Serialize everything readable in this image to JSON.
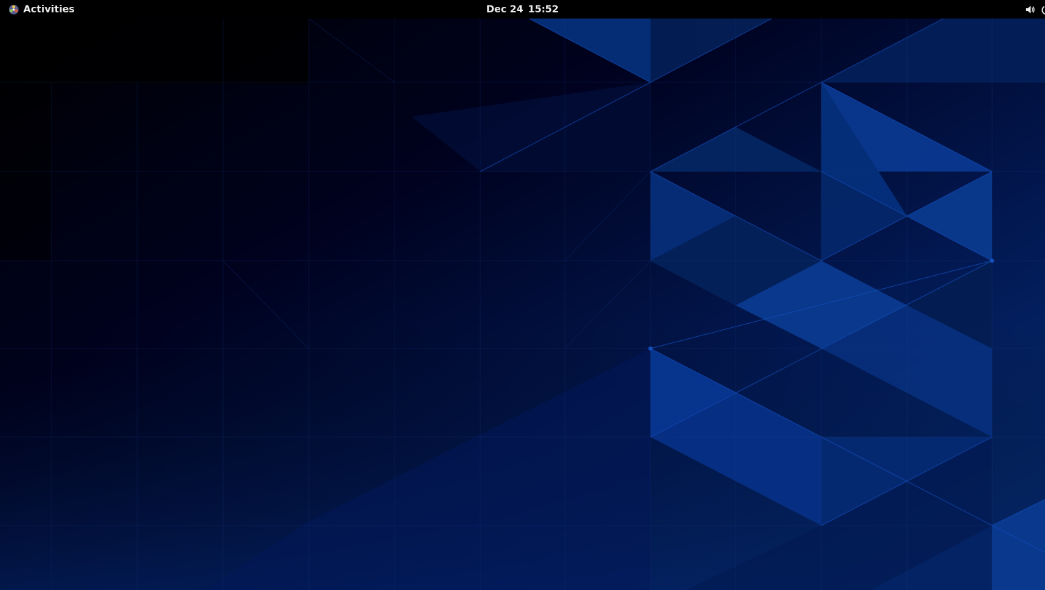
{
  "top_bar": {
    "activities_label": "Activities",
    "clock": {
      "date": "Dec 24",
      "time": "15:52"
    },
    "status_icons": [
      "volume-icon",
      "power-icon"
    ]
  },
  "desktop": {
    "wallpaper": "blue-triangle-pattern"
  },
  "colors": {
    "top_bar_bg": "#000000",
    "text": "#eeeeec",
    "wallpaper_dark": "#000226",
    "wallpaper_blue": "#0a3a8a"
  }
}
